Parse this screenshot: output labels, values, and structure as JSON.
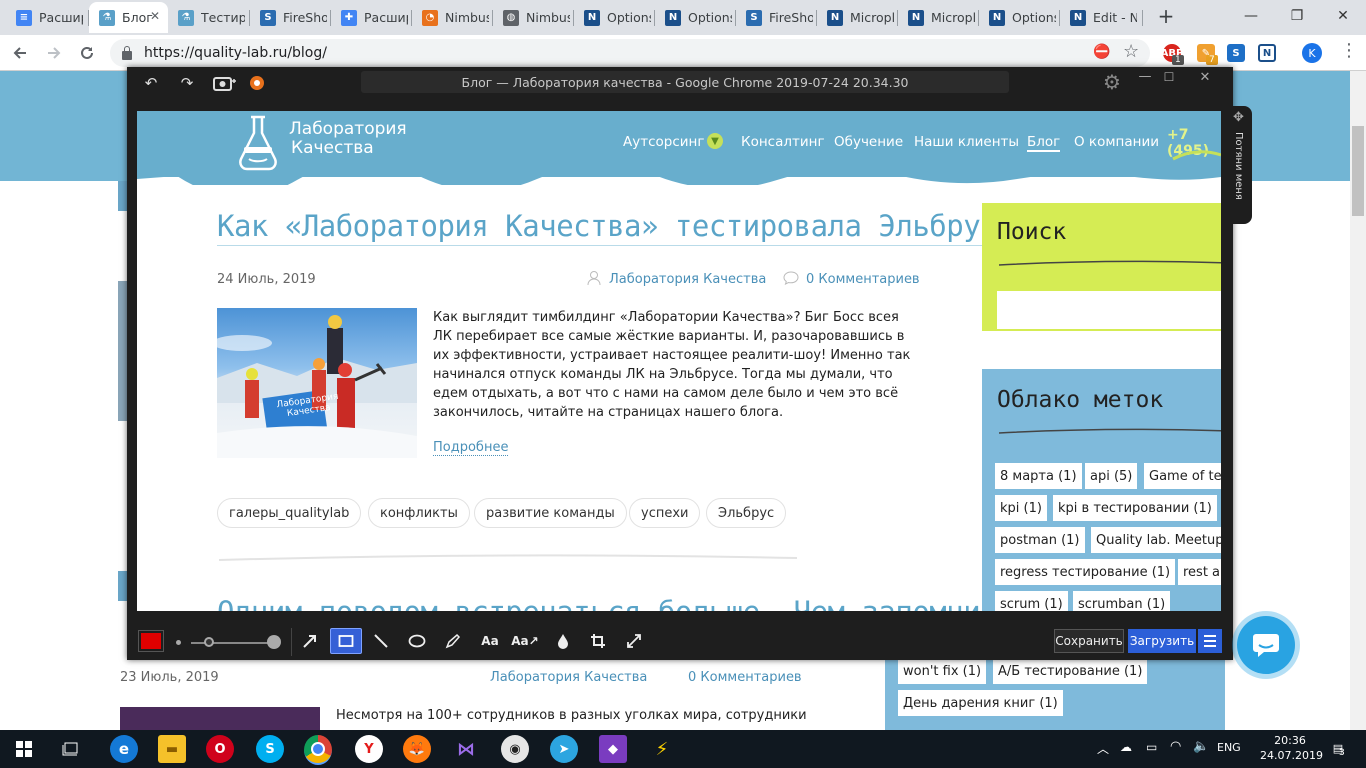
{
  "browser": {
    "tabs": [
      {
        "title": "Расшир",
        "icon": "docs-icon",
        "color": "#4285f4"
      },
      {
        "title": "Блог",
        "icon": "flask-icon",
        "color": "#5aa0c8",
        "active": true
      },
      {
        "title": "Тестир",
        "icon": "flask-icon",
        "color": "#5aa0c8"
      },
      {
        "title": "FireSho",
        "icon": "fireshot-icon",
        "color": "#2b6cb0"
      },
      {
        "title": "Расшир",
        "icon": "puzzle-icon",
        "color": "#4285f4"
      },
      {
        "title": "Nimbus",
        "icon": "nimbus-icon",
        "color": "#e8711c"
      },
      {
        "title": "Nimbus",
        "icon": "globe-icon",
        "color": "#5f6368"
      },
      {
        "title": "Options",
        "icon": "n-icon",
        "color": "#1b4f8a"
      },
      {
        "title": "Options",
        "icon": "n-icon",
        "color": "#1b4f8a"
      },
      {
        "title": "FireSho",
        "icon": "fireshot-icon",
        "color": "#2b6cb0"
      },
      {
        "title": "Micropl",
        "icon": "n-icon",
        "color": "#1b4f8a"
      },
      {
        "title": "Micropl",
        "icon": "n-icon",
        "color": "#1b4f8a"
      },
      {
        "title": "Options",
        "icon": "n-icon",
        "color": "#1b4f8a"
      },
      {
        "title": "Edit - N",
        "icon": "n-icon",
        "color": "#1b4f8a"
      }
    ],
    "new_tab": "+",
    "url": "https://quality-lab.ru/blog/",
    "ext_badges": {
      "abp": "1",
      "rabbit": "7"
    },
    "profile_initial": "K"
  },
  "editor": {
    "title": "Блог — Лаборатория качества - Google Chrome 2019-07-24 20.34.30",
    "side_tab": "Потяни меня",
    "save_label": "Сохранить",
    "upload_label": "Загрузить",
    "color": "#e00000"
  },
  "site": {
    "logo_line1": "Лаборатория",
    "logo_line2": "Качества",
    "nav": [
      "Аутсорсинг",
      "Консалтинг",
      "Обучение",
      "Наши клиенты",
      "Блог",
      "О компании"
    ],
    "phone": "+7 (495)",
    "post": {
      "title": "Как «Лаборатория Качества» тестировала Эльбрус",
      "date": "24 Июль, 2019",
      "author": "Лаборатория Качества",
      "comments": "0 Комментариев",
      "text": "Как выглядит тимбилдинг «Лаборатории Качества»? Биг Босс всея ЛК перебирает все самые жёсткие варианты. И, разочаровавшись в их эффективности, устраивает настоящее реалити-шоу! Именно так начинался отпуск команды ЛК на Эльбрусе. Тогда мы думали, что едем отдыхать, а вот что с нами на самом деле было и чем это всё закончилось, читайте на страницах нашего блога.",
      "more": "Подробнее",
      "tags": [
        "галеры_qualitylab",
        "конфликты",
        "развитие команды",
        "успехи",
        "Эльбрус"
      ],
      "flag_line1": "Лаборатория",
      "flag_line2": "Качества"
    },
    "next_post_title": "Одним поводом встречаться больше. Чем запомнился",
    "sidebar": {
      "search_title": "Поиск",
      "cloud_title": "Облако меток",
      "tags": [
        "8 марта (1)",
        "api (5)",
        "Game of te",
        "kpi (1)",
        "kpi в тестировании (1)",
        "postman (1)",
        "Quality lab. Meetup",
        "regress тестирование (1)",
        "rest a",
        "scrum (1)",
        "scrumban (1)"
      ]
    },
    "bg": {
      "date": "23 Июль, 2019",
      "author": "Лаборатория Качества",
      "comments": "0 Комментариев",
      "text": "Несмотря на 100+ сотрудников в разных уголках мира, сотрудники",
      "tags": [
        "won't fix (1)",
        "А/Б тестирование (1)",
        "День дарения книг (1)"
      ]
    }
  },
  "taskbar": {
    "lang": "ENG",
    "time": "20:36",
    "date": "24.07.2019",
    "notifications": "3"
  }
}
